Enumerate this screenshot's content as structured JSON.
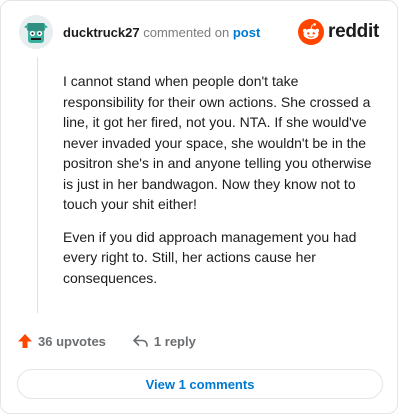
{
  "comment": {
    "author": "ducktruck27",
    "action_text": "commented on",
    "post_link": "post",
    "paragraphs": [
      "I cannot stand when people don't take responsibility for their own actions. She crossed a line, it got her fired, not you. NTA. If she would've never invaded your space, she wouldn't be in the positron she's in and anyone telling you otherwise is just in her bandwagon. Now they know not to touch your shit either!",
      "Even if you did approach management you had every right to. Still, her actions cause her consequences."
    ]
  },
  "brand": {
    "name": "reddit",
    "accent": "#ff4500"
  },
  "actions": {
    "upvotes": "36 upvotes",
    "replies": "1 reply"
  },
  "view_comments_label": "View 1 comments",
  "colors": {
    "link": "#0079d3",
    "upvote": "#ff4500",
    "muted": "#7c7c7c"
  }
}
